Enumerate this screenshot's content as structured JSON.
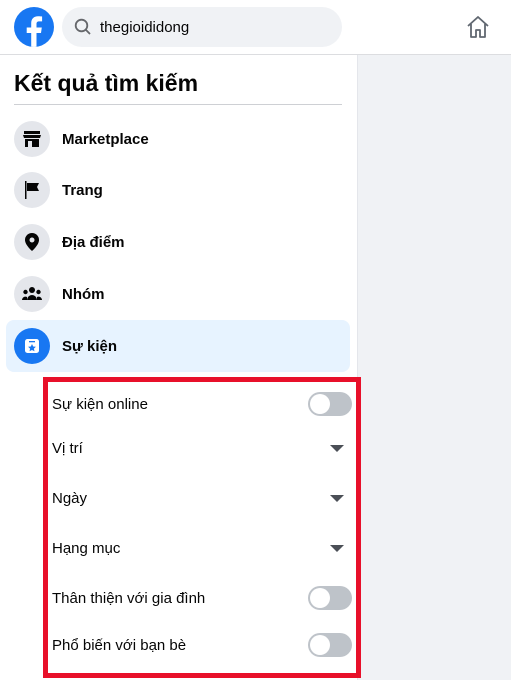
{
  "header": {
    "search_value": "thegioididong",
    "brand_color": "#1877f2"
  },
  "sidebar": {
    "title": "Kết quả tìm kiếm",
    "items": [
      {
        "label": "Marketplace",
        "icon": "shop-icon"
      },
      {
        "label": "Trang",
        "icon": "flag-icon"
      },
      {
        "label": "Địa điểm",
        "icon": "location-pin-icon"
      },
      {
        "label": "Nhóm",
        "icon": "group-icon"
      },
      {
        "label": "Sự kiện",
        "icon": "calendar-star-icon",
        "selected": true
      }
    ]
  },
  "filters": {
    "highlight_color": "#e8102a",
    "rows": [
      {
        "label": "Sự kiện online",
        "type": "toggle",
        "on": false
      },
      {
        "label": "Vị trí",
        "type": "dropdown"
      },
      {
        "label": "Ngày",
        "type": "dropdown"
      },
      {
        "label": "Hạng mục",
        "type": "dropdown"
      },
      {
        "label": "Thân thiện với gia đình",
        "type": "toggle",
        "on": false
      },
      {
        "label": "Phổ biến với bạn bè",
        "type": "toggle",
        "on": false
      }
    ]
  }
}
